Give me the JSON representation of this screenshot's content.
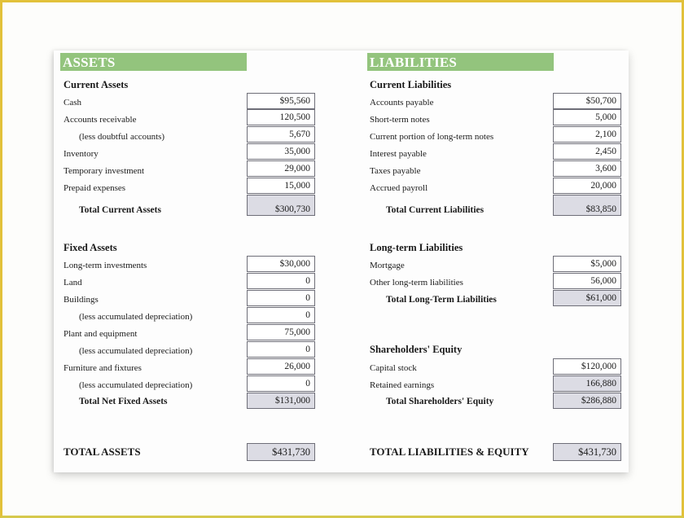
{
  "assets": {
    "header": "ASSETS",
    "current": {
      "title": "Current Assets",
      "items": [
        {
          "label": "Cash",
          "value": "$95,560"
        },
        {
          "label": "Accounts receivable",
          "value": "120,500"
        },
        {
          "label": "(less doubtful accounts)",
          "value": "5,670"
        },
        {
          "label": "Inventory",
          "value": "35,000"
        },
        {
          "label": "Temporary investment",
          "value": "29,000"
        },
        {
          "label": "Prepaid expenses",
          "value": "15,000"
        }
      ],
      "total_label": "Total Current Assets",
      "total_value": "$300,730"
    },
    "fixed": {
      "title": "Fixed Assets",
      "items": [
        {
          "label": "Long-term investments",
          "value": "$30,000"
        },
        {
          "label": "Land",
          "value": "0"
        },
        {
          "label": "Buildings",
          "value": "0"
        },
        {
          "label": "(less accumulated depreciation)",
          "value": "0"
        },
        {
          "label": "Plant and equipment",
          "value": "75,000"
        },
        {
          "label": "(less accumulated depreciation)",
          "value": "0"
        },
        {
          "label": "Furniture and fixtures",
          "value": "26,000"
        },
        {
          "label": "(less accumulated depreciation)",
          "value": "0"
        }
      ],
      "total_label": "Total Net Fixed Assets",
      "total_value": "$131,000"
    },
    "grand_label": "TOTAL ASSETS",
    "grand_value": "$431,730"
  },
  "liabilities": {
    "header": "LIABILITIES",
    "current": {
      "title": "Current Liabilities",
      "items": [
        {
          "label": "Accounts payable",
          "value": "$50,700"
        },
        {
          "label": "Short-term notes",
          "value": "5,000"
        },
        {
          "label": "Current portion of long-term notes",
          "value": "2,100"
        },
        {
          "label": "Interest payable",
          "value": "2,450"
        },
        {
          "label": "Taxes payable",
          "value": "3,600"
        },
        {
          "label": "Accrued payroll",
          "value": "20,000"
        }
      ],
      "total_label": "Total Current Liabilities",
      "total_value": "$83,850"
    },
    "longterm": {
      "title": "Long-term Liabilities",
      "items": [
        {
          "label": "Mortgage",
          "value": "$5,000"
        },
        {
          "label": "Other long-term liabilities",
          "value": "56,000"
        }
      ],
      "total_label": "Total Long-Term Liabilities",
      "total_value": "$61,000"
    },
    "equity": {
      "title": "Shareholders' Equity",
      "items": [
        {
          "label": "Capital stock",
          "value": "$120,000"
        },
        {
          "label": "Retained earnings",
          "value": "166,880"
        }
      ],
      "total_label": "Total Shareholders' Equity",
      "total_value": "$286,880"
    },
    "grand_label": "TOTAL LIABILITIES & EQUITY",
    "grand_value": "$431,730"
  }
}
